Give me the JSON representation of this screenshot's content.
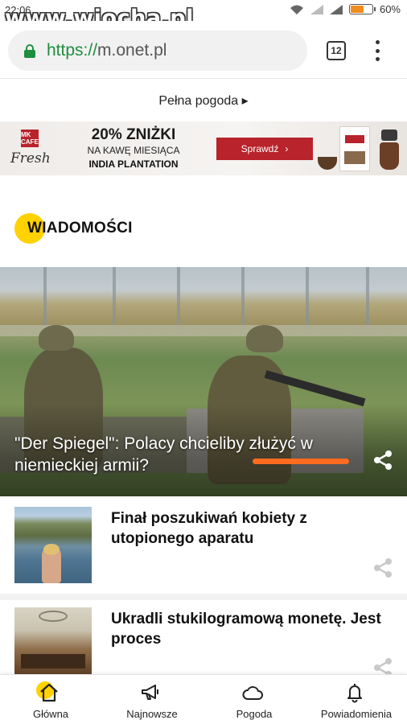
{
  "status_bar": {
    "time": "22:06",
    "battery": "60%",
    "battery_level": 0.6,
    "watermark": "www.wiocha.pl"
  },
  "browser": {
    "url_scheme": "https://",
    "url_host": "m.onet.pl",
    "tab_count": "12",
    "icons": {
      "lock": "lock-icon",
      "menu": "more-vert-icon"
    }
  },
  "weather_link": "Pełna pogoda ▸",
  "ad": {
    "brand_badge": "MK CAFE",
    "brand_script": "Fresh",
    "headline": "20% ZNIŻKI",
    "line2": "NA KAWĘ MIESIĄCA",
    "line3": "INDIA PLANTATION",
    "cta": "Sprawdź",
    "cta_arrow": "›",
    "accent": "#b8232c"
  },
  "section": {
    "title": "WIADOMOŚCI",
    "accent": "#ffd200"
  },
  "hero": {
    "title": "\"Der Spiegel\": Polacy chcieliby złużyć w niemieckiej armii?"
  },
  "articles": [
    {
      "title": "Finał poszukiwań kobiety z utopionego aparatu"
    },
    {
      "title": "Ukradli stukilogramową monetę. Jest proces"
    }
  ],
  "bottom_nav": [
    {
      "label": "Główna",
      "icon": "home-icon",
      "active": true
    },
    {
      "label": "Najnowsze",
      "icon": "megaphone-icon"
    },
    {
      "label": "Pogoda",
      "icon": "cloud-icon"
    },
    {
      "label": "Powiadomienia",
      "icon": "bell-icon"
    }
  ]
}
